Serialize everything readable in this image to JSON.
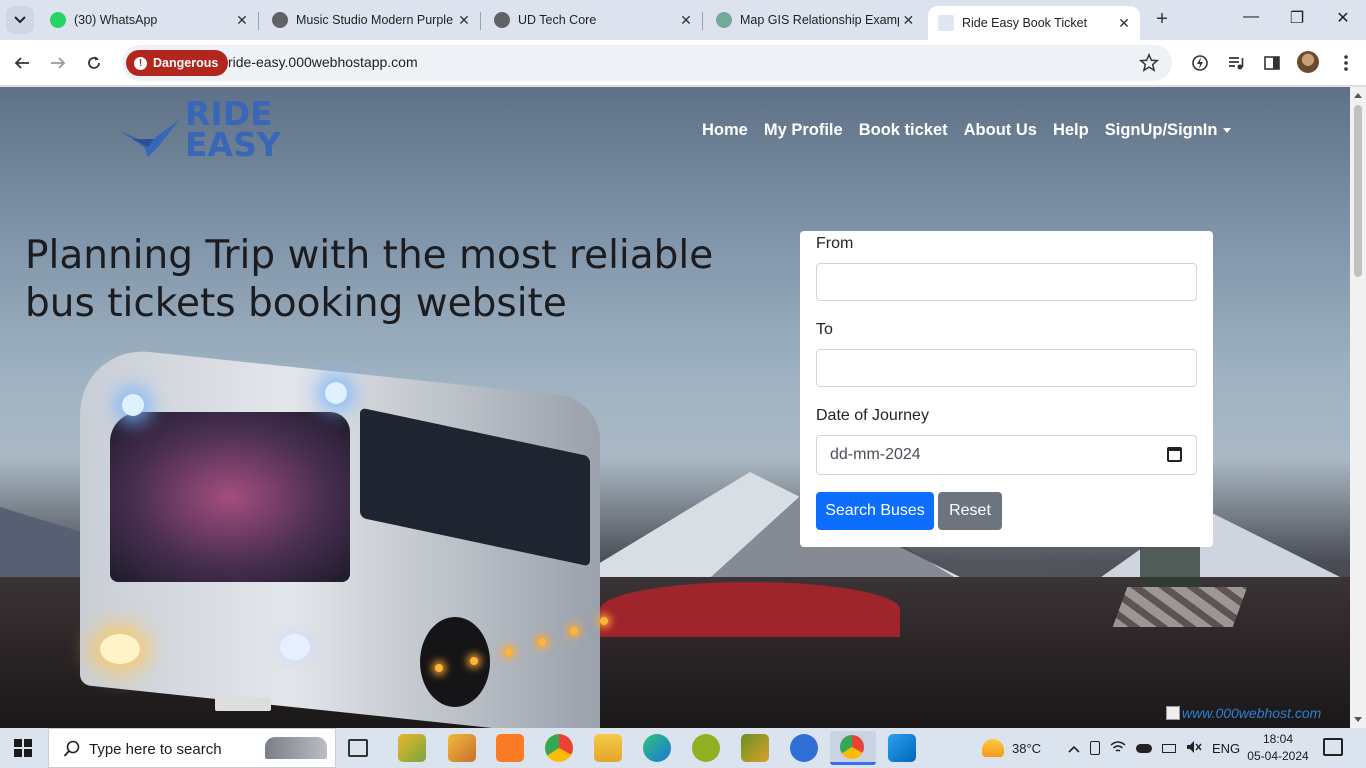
{
  "browser": {
    "tabs": [
      {
        "title": "(30) WhatsApp",
        "favicon": "whatsapp-icon",
        "favicon_color": "#25d366",
        "active": false
      },
      {
        "title": "Music Studio Modern Purple",
        "favicon": "globe-icon",
        "favicon_color": "#5f6368",
        "active": false
      },
      {
        "title": "UD Tech Core",
        "favicon": "globe-icon",
        "favicon_color": "#5f6368",
        "active": false
      },
      {
        "title": "Map GIS Relationship Examp",
        "favicon": "chatgpt-icon",
        "favicon_color": "#74aa9c",
        "active": false
      },
      {
        "title": "Ride Easy Book Ticket",
        "favicon": "ride-easy-favicon",
        "favicon_color": "#3a66b8",
        "active": true
      }
    ],
    "close_glyph": "✕",
    "new_tab_glyph": "+",
    "window_controls": {
      "minimize": "—",
      "maximize": "❐",
      "close": "✕"
    },
    "security_label": "Dangerous",
    "url": "ride-easy.000webhostapp.com"
  },
  "site": {
    "logo": {
      "line1": "RIDE",
      "line2": "EASY",
      "color": "#3a66b8"
    },
    "nav": [
      "Home",
      "My Profile",
      "Book ticket",
      "About Us",
      "Help",
      "SignUp/SignIn"
    ],
    "headline": "Planning Trip with the most reliable bus tickets booking website",
    "form": {
      "from_label": "From",
      "from_value": "",
      "to_label": "To",
      "to_value": "",
      "date_label": "Date of Journey",
      "date_value": "dd-mm-2024",
      "search_button": "Search Buses",
      "reset_button": "Reset",
      "primary_color": "#0d6efd",
      "secondary_color": "#6c757d"
    },
    "host_badge": "www.000webhost.com"
  },
  "taskbar": {
    "search_placeholder": "Type here to search",
    "apps": [
      "task-view-icon",
      "xampp-control-icon",
      "xampp-tool-icon",
      "xampp-icon",
      "chrome-icon",
      "file-explorer-icon",
      "edge-icon",
      "qgis-icon",
      "qgis-tool-icon",
      "translate-icon",
      "chrome-profile-icon",
      "vscode-icon"
    ],
    "weather": "38°C",
    "language": "ENG",
    "time": "18:04",
    "date": "05-04-2024"
  }
}
